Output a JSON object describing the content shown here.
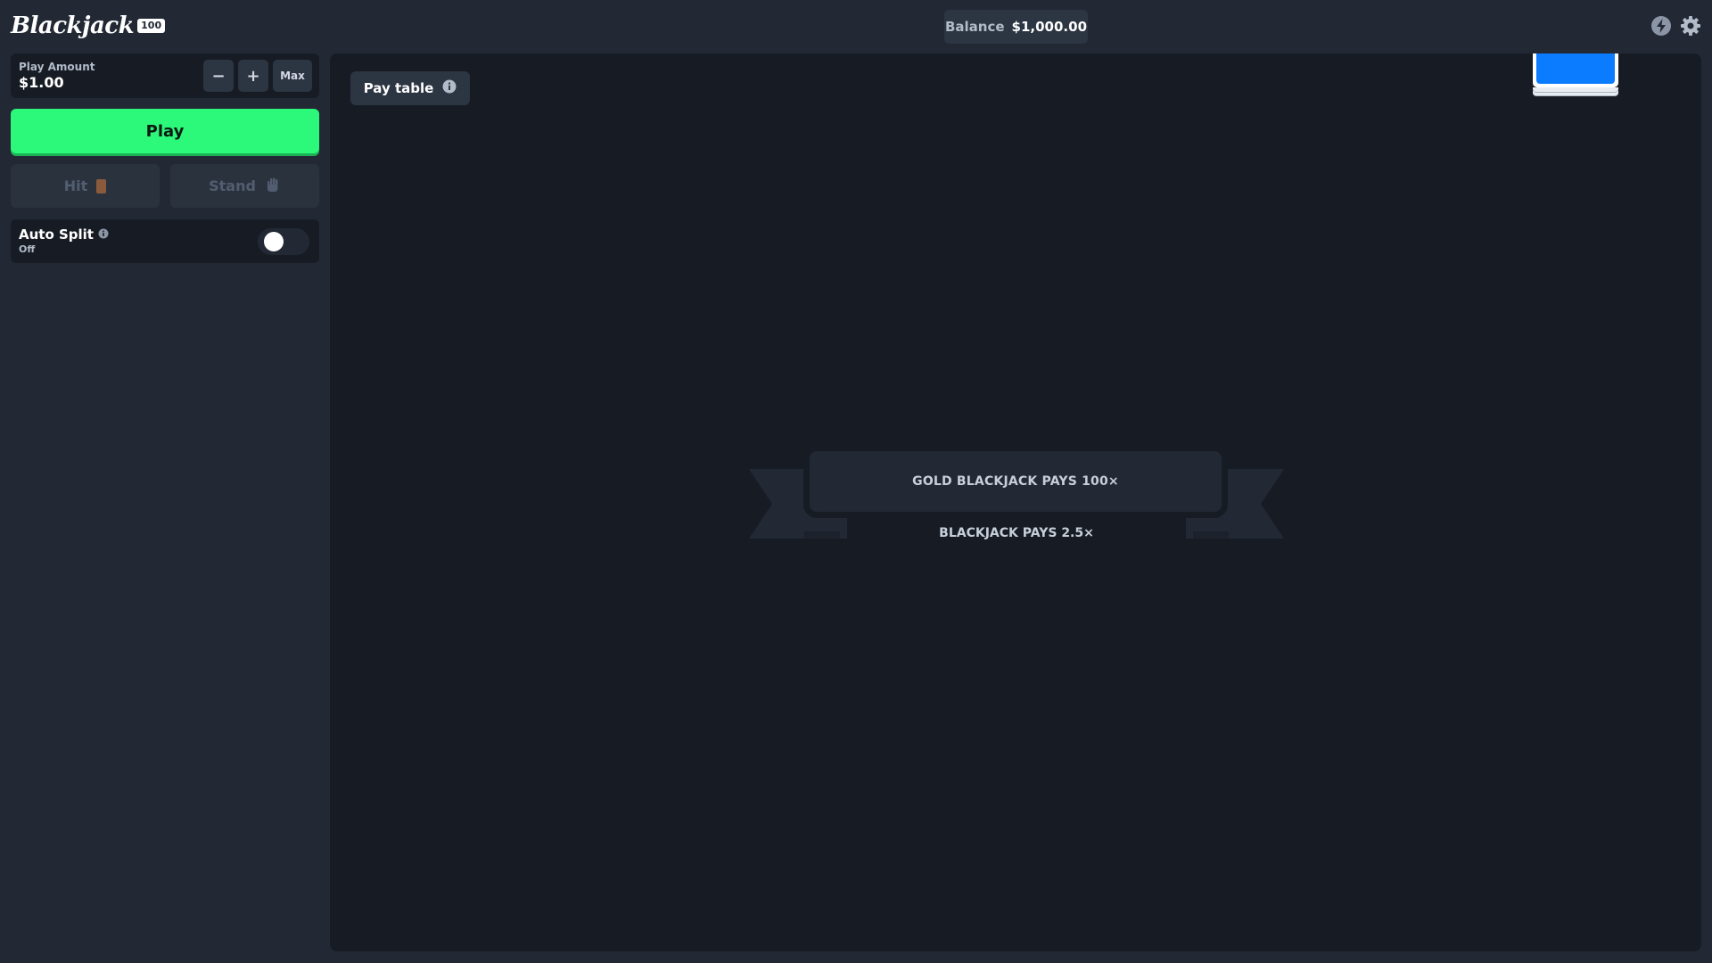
{
  "header": {
    "logo_text": "Blackjack",
    "logo_badge": "100",
    "balance_label": "Balance",
    "balance_value": "$1,000.00",
    "icons": [
      "lightning-icon",
      "gear-icon"
    ]
  },
  "sidebar": {
    "play_amount_label": "Play Amount",
    "play_amount_value": "$1.00",
    "decrease_label": "−",
    "increase_label": "+",
    "max_label": "Max",
    "play_label": "Play",
    "hit_label": "Hit",
    "stand_label": "Stand",
    "auto_split_label": "Auto Split",
    "auto_split_state": "Off",
    "auto_split_on": false
  },
  "table": {
    "pay_table_label": "Pay table",
    "gold_blackjack_text": "GOLD BLACKJACK PAYS 100×",
    "blackjack_text": "BLACKJACK PAYS 2.5×"
  },
  "colors": {
    "background": "#222934",
    "panel": "#171c24",
    "play_green": "#2cf87a",
    "deck_blue": "#0b7cff",
    "hit_icon": "#8a5a3c"
  }
}
